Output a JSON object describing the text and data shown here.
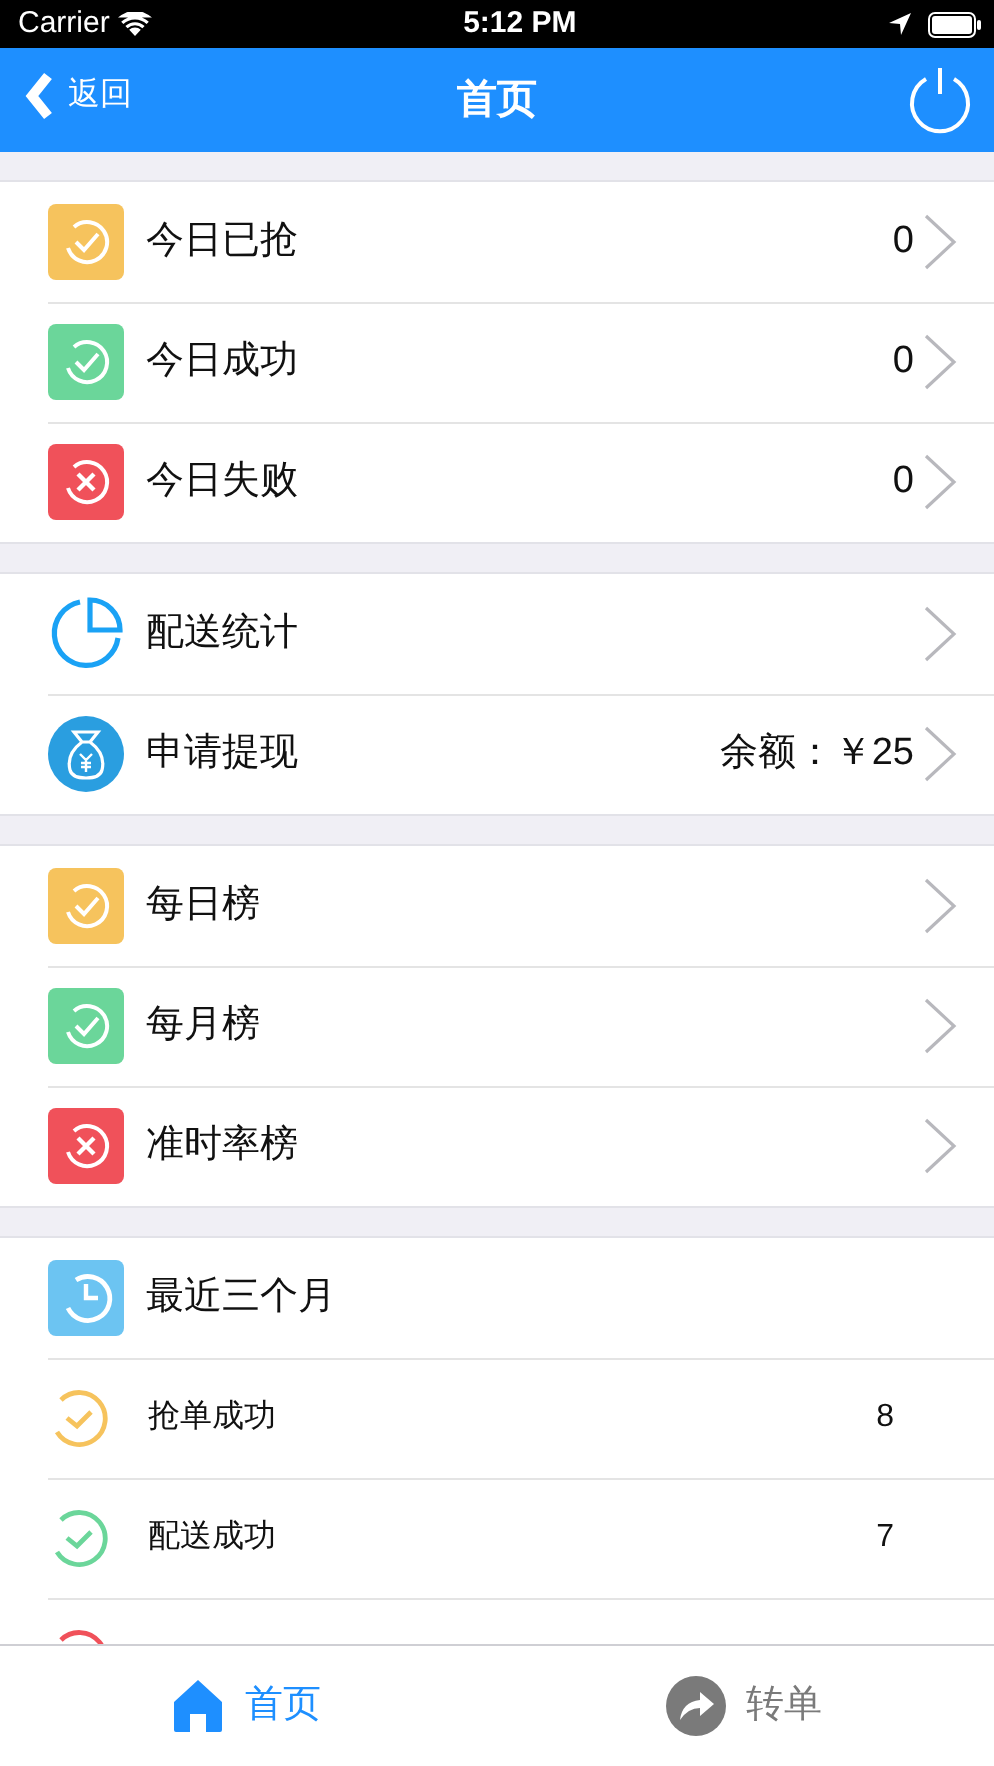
{
  "status_bar": {
    "carrier": "Carrier",
    "time": "5:12 PM"
  },
  "nav": {
    "back": "返回",
    "title": "首页"
  },
  "groups": [
    {
      "rows": [
        {
          "kind": "check-tile",
          "color": "#f6c35d",
          "label": "今日已抢",
          "value": "0",
          "chevron": true
        },
        {
          "kind": "check-tile",
          "color": "#6bd69a",
          "label": "今日成功",
          "value": "0",
          "chevron": true
        },
        {
          "kind": "cross-tile",
          "color": "#f0515a",
          "label": "今日失败",
          "value": "0",
          "chevron": true
        }
      ]
    },
    {
      "rows": [
        {
          "kind": "pie",
          "color": "#1aa2f5",
          "label": "配送统计",
          "chevron": true
        },
        {
          "kind": "money",
          "color": "#2a9ee0",
          "label": "申请提现",
          "value": "余额：￥25",
          "chevron": true
        }
      ]
    },
    {
      "rows": [
        {
          "kind": "check-tile",
          "color": "#f6c35d",
          "label": "每日榜",
          "chevron": true
        },
        {
          "kind": "check-tile",
          "color": "#6bd69a",
          "label": "每月榜",
          "chevron": true
        },
        {
          "kind": "cross-tile",
          "color": "#f0515a",
          "label": "准时率榜",
          "chevron": true
        }
      ]
    },
    {
      "rows": [
        {
          "kind": "clock-tile",
          "color": "#6cc4f2",
          "label": "最近三个月",
          "chevron": false
        },
        {
          "kind": "check-outline",
          "color": "#f6c35d",
          "label": "抢单成功",
          "value": "8",
          "chevron": false
        },
        {
          "kind": "check-outline",
          "color": "#6bd69a",
          "label": "配送成功",
          "value": "7",
          "chevron": false
        },
        {
          "kind": "cross-outline",
          "color": "#f0515a",
          "chevron": false
        }
      ]
    }
  ],
  "tabs": [
    {
      "kind": "home",
      "label": "首页",
      "selected": true
    },
    {
      "kind": "forward",
      "label": "转单",
      "selected": false
    }
  ]
}
